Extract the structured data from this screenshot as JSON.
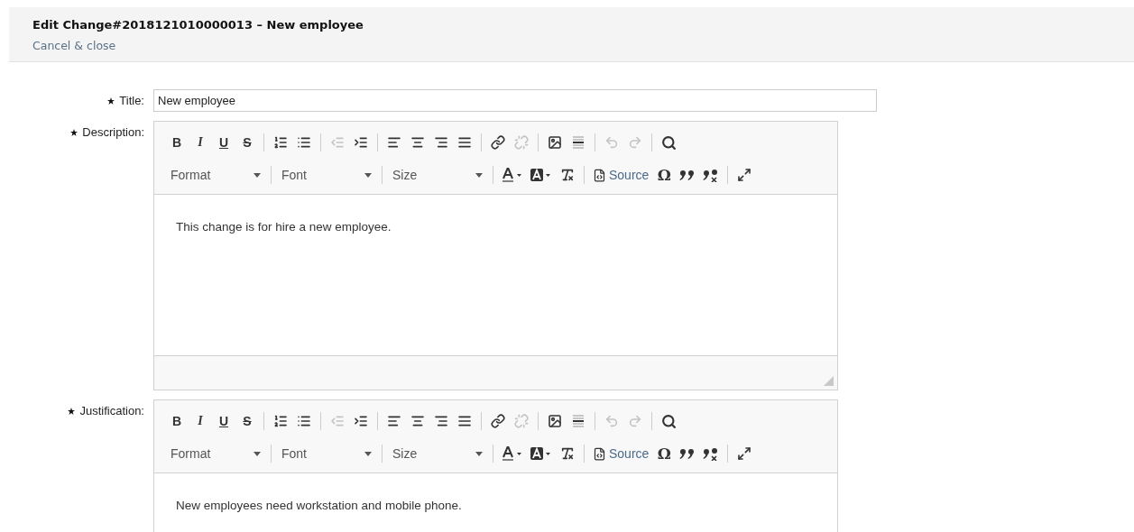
{
  "header": {
    "title": "Edit Change#2018121010000013 – New employee",
    "cancel_link": "Cancel & close"
  },
  "fields": [
    {
      "kind": "text",
      "label": "Title:",
      "required": true,
      "value": "New employee"
    },
    {
      "kind": "editor",
      "label": "Description:",
      "required": true,
      "content": "This change is for hire a new employee.",
      "resizer": true,
      "toolbar": [
        [
          [
            {
              "kind": "bold",
              "label": "B",
              "disabled": false
            },
            {
              "kind": "italic",
              "label": "I",
              "disabled": false
            },
            {
              "kind": "underline",
              "label": "U",
              "disabled": false
            },
            {
              "kind": "strike",
              "label": "S",
              "disabled": false
            }
          ],
          [
            {
              "kind": "numlist",
              "disabled": false
            },
            {
              "kind": "bulletlist",
              "disabled": false
            }
          ],
          [
            {
              "kind": "outdent",
              "disabled": true
            },
            {
              "kind": "indent",
              "disabled": false
            }
          ],
          [
            {
              "kind": "alignleft",
              "disabled": false
            },
            {
              "kind": "aligncenter",
              "disabled": false
            },
            {
              "kind": "alignright",
              "disabled": false
            },
            {
              "kind": "justify",
              "disabled": false
            }
          ],
          [
            {
              "kind": "link",
              "disabled": false
            },
            {
              "kind": "unlink",
              "disabled": true
            }
          ],
          [
            {
              "kind": "image",
              "disabled": false
            },
            {
              "kind": "rule",
              "disabled": false
            }
          ],
          [
            {
              "kind": "undo",
              "disabled": true
            },
            {
              "kind": "redo",
              "disabled": true
            }
          ],
          [
            {
              "kind": "find",
              "disabled": false
            }
          ]
        ],
        [
          [
            {
              "kind": "combo",
              "label": "Format",
              "disabled": false
            }
          ],
          [
            {
              "kind": "combo",
              "label": "Font",
              "disabled": false
            }
          ],
          [
            {
              "kind": "combo",
              "label": "Size",
              "disabled": false
            }
          ],
          [
            {
              "kind": "textcolor",
              "disabled": false
            },
            {
              "kind": "bgcolor",
              "disabled": false
            },
            {
              "kind": "clearformat",
              "disabled": false
            }
          ],
          [
            {
              "kind": "source",
              "label": "Source",
              "disabled": false
            },
            {
              "kind": "glyph",
              "label": "Ω",
              "disabled": false
            },
            {
              "kind": "quote",
              "disabled": false
            },
            {
              "kind": "unquote",
              "disabled": false
            }
          ],
          [
            {
              "kind": "maximize",
              "disabled": false
            }
          ]
        ]
      ]
    },
    {
      "kind": "editor",
      "label": "Justification:",
      "required": true,
      "content": "New employees need workstation and mobile phone.",
      "toolbar": [
        [
          [
            {
              "kind": "bold",
              "label": "B",
              "disabled": false
            },
            {
              "kind": "italic",
              "label": "I",
              "disabled": false
            },
            {
              "kind": "underline",
              "label": "U",
              "disabled": false
            },
            {
              "kind": "strike",
              "label": "S",
              "disabled": false
            }
          ],
          [
            {
              "kind": "numlist",
              "disabled": false
            },
            {
              "kind": "bulletlist",
              "disabled": false
            }
          ],
          [
            {
              "kind": "outdent",
              "disabled": true
            },
            {
              "kind": "indent",
              "disabled": false
            }
          ],
          [
            {
              "kind": "alignleft",
              "disabled": false
            },
            {
              "kind": "aligncenter",
              "disabled": false
            },
            {
              "kind": "alignright",
              "disabled": false
            },
            {
              "kind": "justify",
              "disabled": false
            }
          ],
          [
            {
              "kind": "link",
              "disabled": false
            },
            {
              "kind": "unlink",
              "disabled": true
            }
          ],
          [
            {
              "kind": "image",
              "disabled": false
            },
            {
              "kind": "rule",
              "disabled": false
            }
          ],
          [
            {
              "kind": "undo",
              "disabled": true
            },
            {
              "kind": "redo",
              "disabled": true
            }
          ],
          [
            {
              "kind": "find",
              "disabled": false
            }
          ]
        ],
        [
          [
            {
              "kind": "combo",
              "label": "Format",
              "disabled": false
            }
          ],
          [
            {
              "kind": "combo",
              "label": "Font",
              "disabled": false
            }
          ],
          [
            {
              "kind": "combo",
              "label": "Size",
              "disabled": false
            }
          ],
          [
            {
              "kind": "textcolor",
              "disabled": false
            },
            {
              "kind": "bgcolor",
              "disabled": false
            },
            {
              "kind": "clearformat",
              "disabled": false
            }
          ],
          [
            {
              "kind": "source",
              "label": "Source",
              "disabled": false
            },
            {
              "kind": "glyph",
              "label": "Ω",
              "disabled": false
            },
            {
              "kind": "quote",
              "disabled": false
            },
            {
              "kind": "unquote",
              "disabled": false
            }
          ],
          [
            {
              "kind": "maximize",
              "disabled": false
            }
          ]
        ]
      ]
    }
  ]
}
